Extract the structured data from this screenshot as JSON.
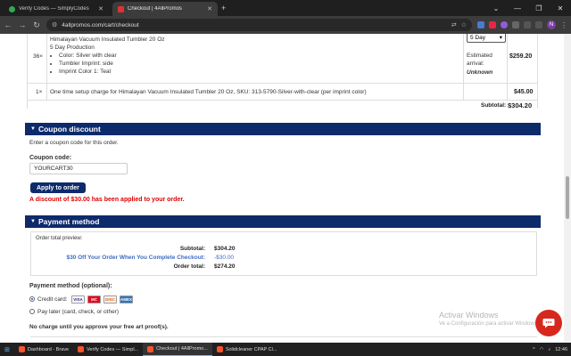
{
  "browser": {
    "tabs": [
      {
        "title": "Verify Codes — SimplyCodes",
        "active": false
      },
      {
        "title": "Checkout | 4AllPromos",
        "active": true
      }
    ],
    "url": "4allpromos.com/cart/checkout",
    "new_tab": "+",
    "profile_initial": "N"
  },
  "items": {
    "product_name": "Himalayan Vacuum Insulated Tumbler 20 Oz",
    "production": "5 Day Production",
    "options": [
      "Color: Silver with clear",
      "Tumbler Imprint: side",
      "Imprint Color 1: Teal"
    ],
    "qty": "36×",
    "shipping_select": "5 Day",
    "estimated_label": "Estimated arrival:",
    "estimated_value": "Unknown",
    "price": "$259.20",
    "setup_qty": "1×",
    "setup_desc": "One time setup charge for Himalayan Vacuum Insulated Tumbler 20 Oz, SKU: 313-5790-Silver-with-clear (per imprint color)",
    "setup_price": "$45.00",
    "subtotal_label": "Subtotal:",
    "subtotal_value": "$304.20"
  },
  "coupon": {
    "header": "Coupon discount",
    "instruction": "Enter a coupon code for this order.",
    "code_label": "Coupon code:",
    "code_value": "YOURCART30",
    "apply_button": "Apply to order",
    "applied_message": "A discount of $30.00 has been applied to your order."
  },
  "payment": {
    "header": "Payment method",
    "preview_title": "Order total preview:",
    "subtotal_label": "Subtotal:",
    "subtotal_value": "$304.20",
    "discount_label": "$30 Off Your Order When You Complete Checkout:",
    "discount_value": "-$30.00",
    "total_label": "Order total:",
    "total_value": "$274.20",
    "method_label": "Payment method (optional):",
    "option_credit": "Credit card:",
    "option_later": "Pay later (card, check, or other)",
    "cards": [
      "VISA",
      "MC",
      "DISC",
      "AMEX"
    ],
    "no_charge": "No charge until you approve your free art proof(s)."
  },
  "watermark": {
    "line1": "Activar Windows",
    "line2": "Ve a Configuración para activar Windows."
  },
  "taskbar": {
    "items": [
      "Dashboard - Brave",
      "Verify Codes — Simpl...",
      "Checkout | 4AllPromo...",
      "Solidcleaner CPAP Cl..."
    ],
    "clock": "12:46"
  }
}
